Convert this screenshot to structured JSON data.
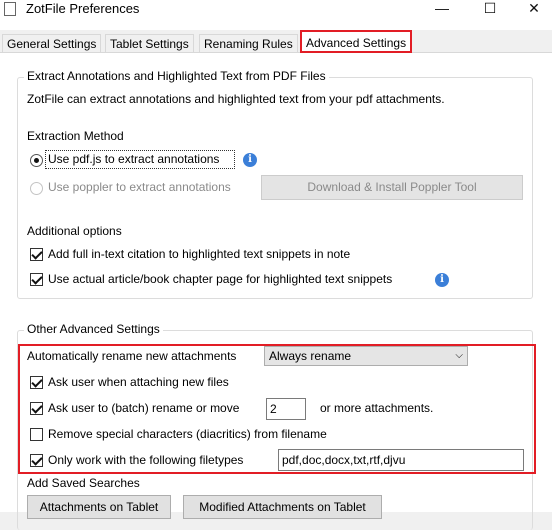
{
  "window": {
    "title": "ZotFile Preferences",
    "minimize": "—",
    "maximize": "☐",
    "close": "✕"
  },
  "tabs": [
    {
      "label": "General Settings",
      "active": false
    },
    {
      "label": "Tablet Settings",
      "active": false
    },
    {
      "label": "Renaming Rules",
      "active": false
    },
    {
      "label": "Advanced Settings",
      "active": true
    }
  ],
  "extract": {
    "legend": "Extract Annotations and Highlighted Text from PDF Files",
    "description": "ZotFile can extract annotations and highlighted text from your pdf attachments.",
    "method_heading": "Extraction Method",
    "option_pdfjs": "Use pdf.js to extract annotations",
    "option_poppler": "Use poppler to extract annotations",
    "poppler_button": "Download & Install Poppler Tool",
    "additional_heading": "Additional options",
    "opt_citation": "Add full in-text citation to highlighted text snippets in note",
    "opt_page": "Use actual article/book chapter page for highlighted text snippets",
    "info_glyph": "i"
  },
  "other": {
    "legend": "Other Advanced Settings",
    "auto_rename_label": "Automatically rename new attachments",
    "auto_rename_value": "Always rename",
    "ask_attach": "Ask user when attaching new files",
    "ask_batch": "Ask user to (batch) rename or move",
    "batch_count": "2",
    "batch_suffix": "or more attachments.",
    "remove_special": "Remove special characters (diacritics) from filename",
    "only_filetypes": "Only work with the following filetypes",
    "filetypes_value": "pdf,doc,docx,txt,rtf,djvu",
    "chevron": "⌵"
  },
  "saved_searches": {
    "heading": "Add Saved Searches",
    "btn_tablet": "Attachments on Tablet",
    "btn_modified": "Modified Attachments on Tablet"
  }
}
